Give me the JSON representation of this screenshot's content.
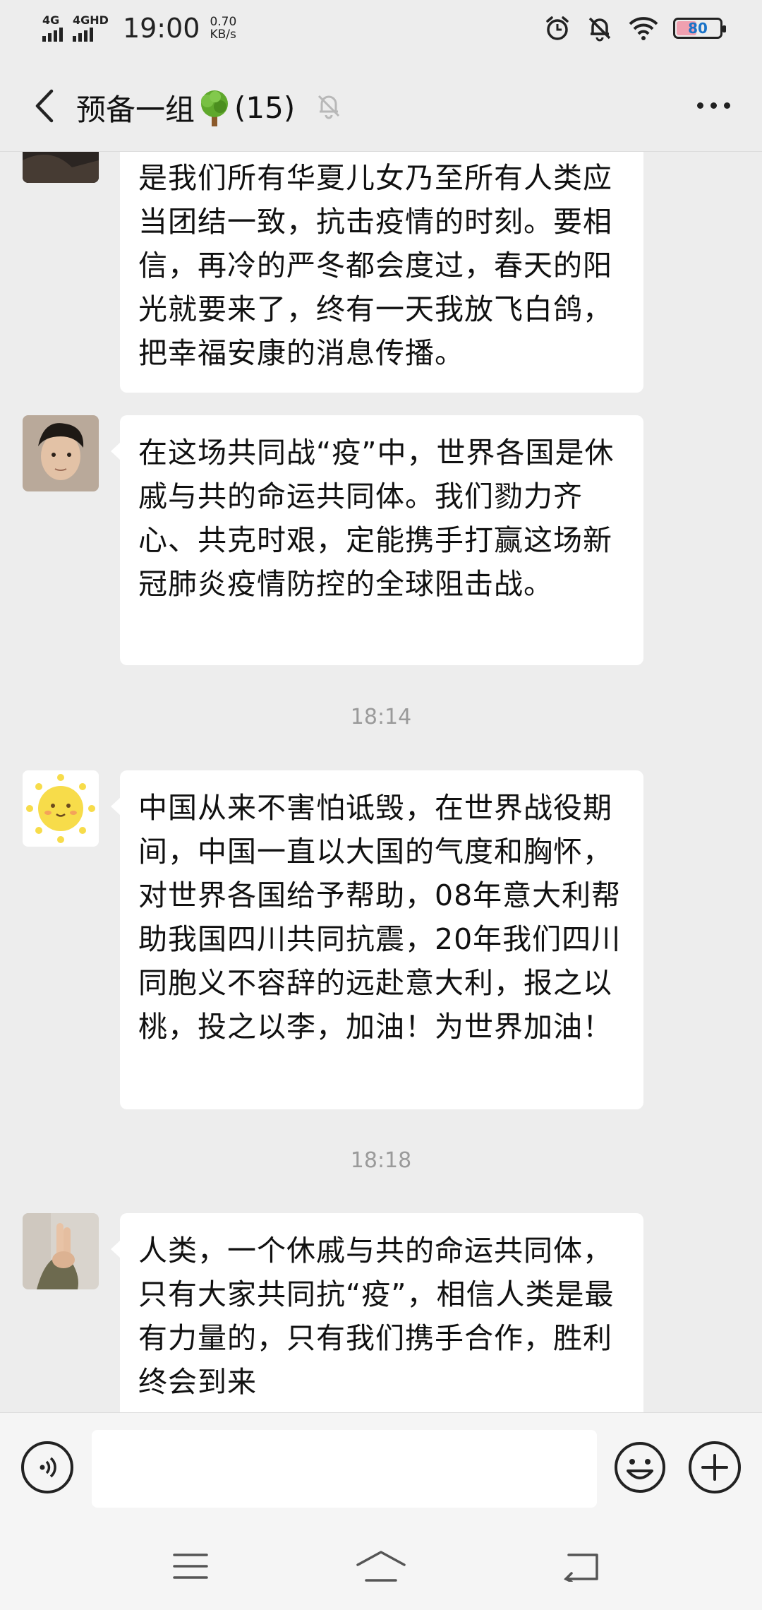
{
  "status_bar": {
    "net1": "4G",
    "net2": "4GHD",
    "time": "19:00",
    "speed_value": "0.70",
    "speed_unit": "KB/s",
    "battery": "80"
  },
  "header": {
    "back_icon": "chevron-left-icon",
    "group_name": "预备一组",
    "member_count": "(15)",
    "mute_icon": "bell-muted-icon",
    "more_icon": "more-dots-icon"
  },
  "messages": [
    {
      "id": "m1",
      "text": "是我们所有华夏儿女乃至所有人类应当团结一致，抗击疫情的时刻。要相信，再冷的严冬都会度过，春天的阳光就要来了，终有一天我放飞白鸽，把幸福安康的消息传播。"
    },
    {
      "id": "m2",
      "text": "在这场共同战“疫”中，世界各国是休戚与共的命运共同体。我们勠力齐心、共克时艰，定能携手打赢这场新冠肺炎疫情防控的全球阻击战。"
    },
    {
      "id": "m3",
      "time": "18:14",
      "text": "中国从来不害怕诋毁，在世界战役期间，中国一直以大国的气度和胸怀，对世界各国给予帮助，08年意大利帮助我国四川共同抗震，20年我们四川同胞义不容辞的远赴意大利，报之以桃，投之以李，加油！为世界加油！"
    },
    {
      "id": "m4",
      "time": "18:18",
      "text": "人类，一个休戚与共的命运共同体，只有大家共同抗“疫”，相信人类是最有力量的，只有我们携手合作，胜利终会到来"
    }
  ],
  "input_bar": {
    "voice_icon": "voice-icon",
    "text_value": "",
    "emoji_icon": "emoji-icon",
    "plus_icon": "plus-icon"
  },
  "nav_bar": {
    "menu_icon": "menu-icon",
    "home_icon": "home-icon",
    "back_icon": "back-icon"
  }
}
